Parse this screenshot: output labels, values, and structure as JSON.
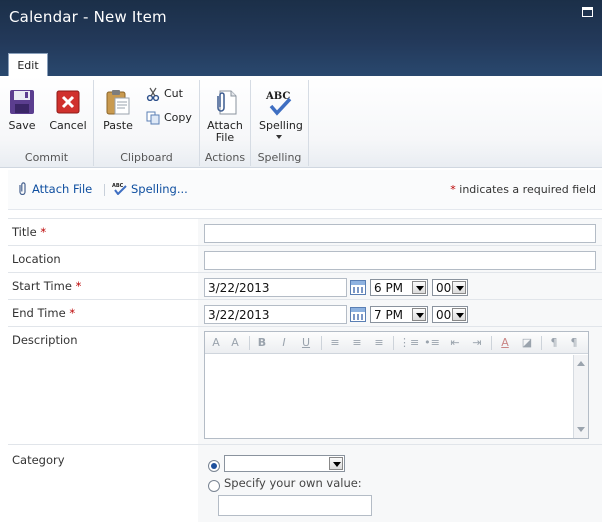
{
  "window": {
    "title": "Calendar - New Item"
  },
  "ribbon": {
    "tab_label": "Edit",
    "commit": {
      "label": "Commit",
      "save": "Save",
      "cancel": "Cancel"
    },
    "clipboard": {
      "label": "Clipboard",
      "paste": "Paste",
      "cut": "Cut",
      "copy": "Copy"
    },
    "actions": {
      "label": "Actions",
      "attach_line1": "Attach",
      "attach_line2": "File"
    },
    "spelling": {
      "label": "Spelling",
      "button": "Spelling",
      "icon_text": "ABC"
    }
  },
  "toolbar": {
    "attach_file": "Attach File",
    "spelling": "Spelling...",
    "required_star": "*",
    "required_note": "indicates a required field"
  },
  "form": {
    "title": {
      "label": "Title",
      "required": "*",
      "value": ""
    },
    "location": {
      "label": "Location",
      "value": ""
    },
    "start_time": {
      "label": "Start Time",
      "required": "*",
      "date": "3/22/2013",
      "hour": "6 PM",
      "minute": "00"
    },
    "end_time": {
      "label": "End Time",
      "required": "*",
      "date": "3/22/2013",
      "hour": "7 PM",
      "minute": "00"
    },
    "description": {
      "label": "Description",
      "toolbar": [
        "A",
        "A",
        "B",
        "I",
        "U",
        "≡",
        "≡",
        "≡",
        "⋮≡",
        "•≡",
        "⇤",
        "⇥",
        "A",
        "◪",
        "¶",
        "¶"
      ]
    },
    "category": {
      "label": "Category",
      "selected": "",
      "own_value_label": "Specify your own value:",
      "own_value": ""
    }
  },
  "colors": {
    "titlebar": "#23395a",
    "link": "#0f4fa0",
    "required": "#b00000"
  }
}
